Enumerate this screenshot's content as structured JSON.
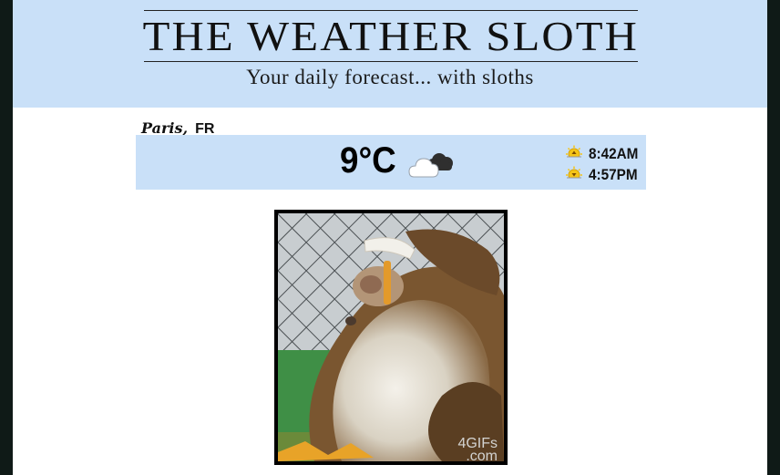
{
  "header": {
    "title": "THE WEATHER SLOTH",
    "subtitle": "Your daily forecast... with sloths"
  },
  "location": {
    "city": "Paris,",
    "country": "FR"
  },
  "weather": {
    "temperature": "9°C",
    "condition_icon": "cloudy-icon",
    "sunrise": "8:42AM",
    "sunset": "4:57PM"
  },
  "gif": {
    "watermark_line1": "4GIFs",
    "watermark_line2": ".com"
  },
  "colors": {
    "header_bg": "#c9e0f8",
    "page_bg": "#ffffff",
    "outer_bg": "#0f1a17"
  }
}
